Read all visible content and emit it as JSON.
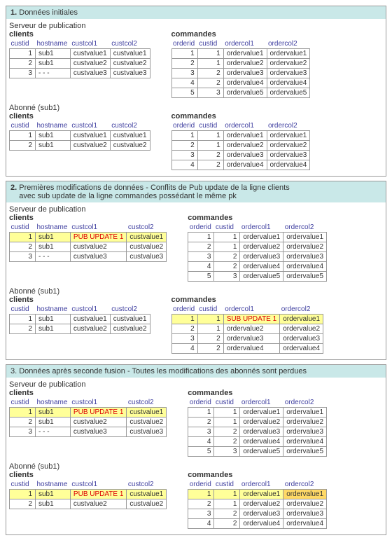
{
  "s1": {
    "title_b": "1.",
    "title": "Données initiales",
    "pub": "Serveur de publication",
    "sub": "Abonné (sub1)",
    "tbl_clients": "clients",
    "tbl_commandes": "commandes",
    "ch": [
      "custid",
      "hostname",
      "custcol1",
      "custcol2"
    ],
    "oh": [
      "orderid",
      "custid",
      "ordercol1",
      "ordercol2"
    ],
    "pub_c": [
      [
        "1",
        "sub1",
        "custvalue1",
        "custvalue1"
      ],
      [
        "2",
        "sub1",
        "custvalue2",
        "custvalue2"
      ],
      [
        "3",
        "- - -",
        "custvalue3",
        "custvalue3"
      ]
    ],
    "pub_o": [
      [
        "1",
        "1",
        "ordervalue1",
        "ordervalue1"
      ],
      [
        "2",
        "1",
        "ordervalue2",
        "ordervalue2"
      ],
      [
        "3",
        "2",
        "ordervalue3",
        "ordervalue3"
      ],
      [
        "4",
        "2",
        "ordervalue4",
        "ordervalue4"
      ],
      [
        "5",
        "3",
        "ordervalue5",
        "ordervalue5"
      ]
    ],
    "sub_c": [
      [
        "1",
        "sub1",
        "custvalue1",
        "custvalue1"
      ],
      [
        "2",
        "sub1",
        "custvalue2",
        "custvalue2"
      ]
    ],
    "sub_o": [
      [
        "1",
        "1",
        "ordervalue1",
        "ordervalue1"
      ],
      [
        "2",
        "1",
        "ordervalue2",
        "ordervalue2"
      ],
      [
        "3",
        "2",
        "ordervalue3",
        "ordervalue3"
      ],
      [
        "4",
        "2",
        "ordervalue4",
        "ordervalue4"
      ]
    ]
  },
  "s2": {
    "title_b": "2.",
    "title": "Premières modifications de données - Conflits de Pub update de la ligne clients",
    "title2": "avec sub update de la ligne commandes possédant le même pk",
    "pub": "Serveur de publication",
    "sub": "Abonné (sub1)",
    "tbl_clients": "clients",
    "tbl_commandes": "commandes",
    "ch": [
      "custid",
      "hostname",
      "custcol1",
      "custcol2"
    ],
    "oh": [
      "orderid",
      "custid",
      "ordercol1",
      "ordercol2"
    ],
    "pub_c": [
      [
        "1",
        "sub1",
        "PUB UPDATE 1",
        "custvalue1"
      ],
      [
        "2",
        "sub1",
        "custvalue2",
        "custvalue2"
      ],
      [
        "3",
        "- - -",
        "custvalue3",
        "custvalue3"
      ]
    ],
    "pub_o": [
      [
        "1",
        "1",
        "ordervalue1",
        "ordervalue1"
      ],
      [
        "2",
        "1",
        "ordervalue2",
        "ordervalue2"
      ],
      [
        "3",
        "2",
        "ordervalue3",
        "ordervalue3"
      ],
      [
        "4",
        "2",
        "ordervalue4",
        "ordervalue4"
      ],
      [
        "5",
        "3",
        "ordervalue5",
        "ordervalue5"
      ]
    ],
    "sub_c": [
      [
        "1",
        "sub1",
        "custvalue1",
        "custvalue1"
      ],
      [
        "2",
        "sub1",
        "custvalue2",
        "custvalue2"
      ]
    ],
    "sub_o": [
      [
        "1",
        "1",
        "SUB UPDATE 1",
        "ordervalue1"
      ],
      [
        "2",
        "1",
        "ordervalue2",
        "ordervalue2"
      ],
      [
        "3",
        "2",
        "ordervalue3",
        "ordervalue3"
      ],
      [
        "4",
        "2",
        "ordervalue4",
        "ordervalue4"
      ]
    ]
  },
  "s3": {
    "title": "3. Données après seconde fusion - Toutes les modifications des abonnés sont perdues",
    "pub": "Serveur de publication",
    "sub": "Abonné (sub1)",
    "tbl_clients": "clients",
    "tbl_commandes": "commandes",
    "ch": [
      "custid",
      "hostname",
      "custcol1",
      "custcol2"
    ],
    "oh": [
      "orderid",
      "custid",
      "ordercol1",
      "ordercol2"
    ],
    "pub_c": [
      [
        "1",
        "sub1",
        "PUB UPDATE 1",
        "custvalue1"
      ],
      [
        "2",
        "sub1",
        "custvalue2",
        "custvalue2"
      ],
      [
        "3",
        "- - -",
        "custvalue3",
        "custvalue3"
      ]
    ],
    "pub_o": [
      [
        "1",
        "1",
        "ordervalue1",
        "ordervalue1"
      ],
      [
        "2",
        "1",
        "ordervalue2",
        "ordervalue2"
      ],
      [
        "3",
        "2",
        "ordervalue3",
        "ordervalue3"
      ],
      [
        "4",
        "2",
        "ordervalue4",
        "ordervalue4"
      ],
      [
        "5",
        "3",
        "ordervalue5",
        "ordervalue5"
      ]
    ],
    "sub_c": [
      [
        "1",
        "sub1",
        "PUB UPDATE 1",
        "custvalue1"
      ],
      [
        "2",
        "sub1",
        "custvalue2",
        "custvalue2"
      ]
    ],
    "sub_o": [
      [
        "1",
        "1",
        "ordervalue1",
        "ordervalue1"
      ],
      [
        "2",
        "1",
        "ordervalue2",
        "ordervalue2"
      ],
      [
        "3",
        "2",
        "ordervalue3",
        "ordervalue3"
      ],
      [
        "4",
        "2",
        "ordervalue4",
        "ordervalue4"
      ]
    ]
  }
}
